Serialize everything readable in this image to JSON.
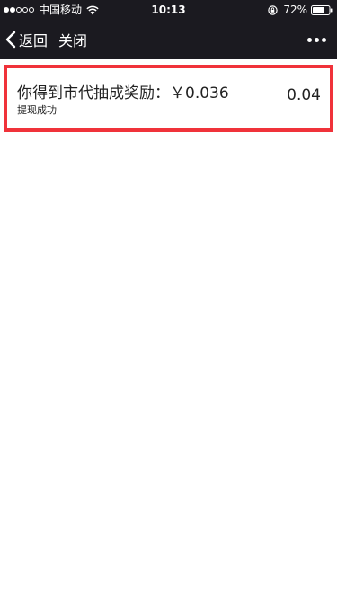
{
  "status_bar": {
    "signal_filled": 2,
    "signal_total": 5,
    "carrier": "中国移动",
    "time": "10:13",
    "battery_percent": "72%",
    "battery_level": 0.72
  },
  "nav": {
    "back_label": "返回",
    "close_label": "关闭"
  },
  "record": {
    "title": "你得到市代抽成奖励：￥0.036",
    "status": "提现成功",
    "amount": "0.04"
  },
  "colors": {
    "bar_background": "#1b1a20",
    "highlight_border": "#f0323a"
  }
}
